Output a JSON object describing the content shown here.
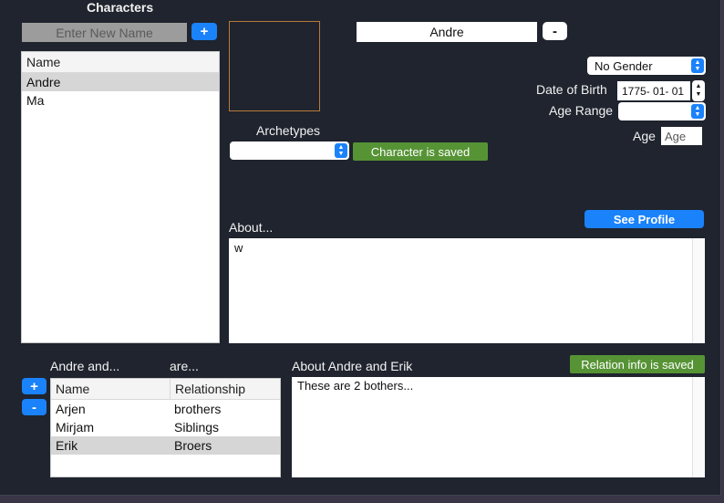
{
  "characters_panel": {
    "title": "Characters",
    "new_name_placeholder": "Enter New Name",
    "add_label": "+",
    "list_header": "Name",
    "names": [
      "Andre",
      "Ma"
    ],
    "selected_index": 0
  },
  "profile": {
    "name_value": "Andre",
    "remove_label": "-",
    "gender_value": "No Gender",
    "date_of_birth_label": "Date of Birth",
    "date_of_birth_value": "1775- 01- 01",
    "age_range_label": "Age Range",
    "age_range_value": "",
    "age_label": "Age",
    "age_placeholder": "Age",
    "archetypes_label": "Archetypes",
    "archetype_value": "",
    "saved_badge": "Character is saved",
    "see_profile_label": "See Profile",
    "about_label": "About...",
    "about_text": "w"
  },
  "relations": {
    "subject_label": "Andre and...",
    "are_label": "are...",
    "add_label": "+",
    "remove_label": "-",
    "columns": [
      "Name",
      "Relationship"
    ],
    "rows": [
      {
        "name": "Arjen",
        "relationship": "brothers"
      },
      {
        "name": "Mirjam",
        "relationship": "Siblings"
      },
      {
        "name": "Erik",
        "relationship": "Broers"
      }
    ],
    "selected_index": 2,
    "about_label": "About Andre and Erik",
    "saved_badge": "Relation info is saved",
    "about_text": "These are 2 bothers..."
  },
  "colors": {
    "window_bg": "#1f242e",
    "accent_blue": "#1a82fb",
    "saved_green": "#569335",
    "image_border": "#b87a3a"
  }
}
